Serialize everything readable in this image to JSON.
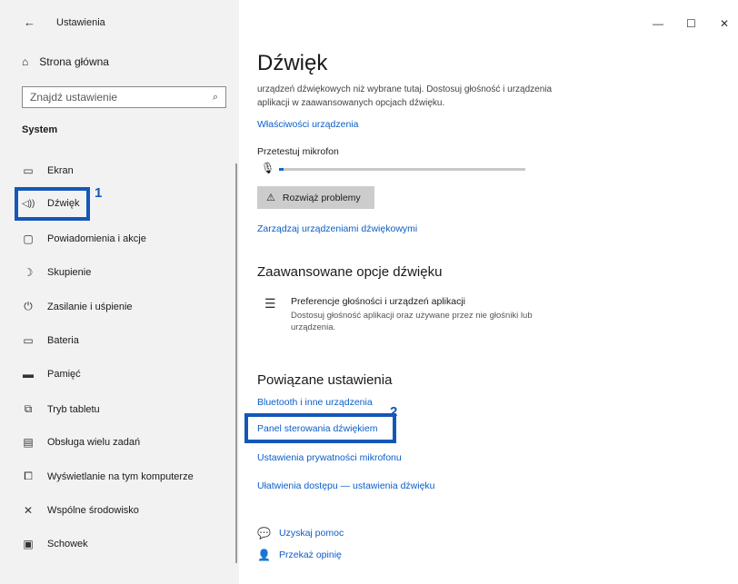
{
  "titlebar": {
    "title": "Ustawienia"
  },
  "sidebar": {
    "home_label": "Strona główna",
    "search_placeholder": "Znajdź ustawienie",
    "section": "System",
    "items": [
      {
        "label": "Ekran",
        "icon": "monitor-icon"
      },
      {
        "label": "Dźwięk",
        "icon": "speaker-icon"
      },
      {
        "label": "Powiadomienia i akcje",
        "icon": "notification-icon"
      },
      {
        "label": "Skupienie",
        "icon": "moon-icon"
      },
      {
        "label": "Zasilanie i uśpienie",
        "icon": "power-icon"
      },
      {
        "label": "Bateria",
        "icon": "battery-icon"
      },
      {
        "label": "Pamięć",
        "icon": "storage-icon"
      },
      {
        "label": "Tryb tabletu",
        "icon": "tablet-icon"
      },
      {
        "label": "Obsługa wielu zadań",
        "icon": "multitask-icon"
      },
      {
        "label": "Wyświetlanie na tym komputerze",
        "icon": "projecting-icon"
      },
      {
        "label": "Wspólne środowisko",
        "icon": "shared-experience-icon"
      },
      {
        "label": "Schowek",
        "icon": "clipboard-icon"
      }
    ],
    "callout": "1"
  },
  "main": {
    "title": "Dźwięk",
    "description": "urządzeń dźwiękowych niż wybrane tutaj. Dostosuj głośność i urządzenia aplikacji w zaawansowanych opcjach dźwięku.",
    "device_props_link": "Właściwości urządzenia",
    "mic_test_label": "Przetestuj mikrofon",
    "mic_level": 0.02,
    "troubleshoot_label": "Rozwiąż problemy",
    "manage_devices_link": "Zarządzaj urządzeniami dźwiękowymi",
    "advanced_heading": "Zaawansowane opcje dźwięku",
    "app_pref_title": "Preferencje głośności i urządzeń aplikacji",
    "app_pref_desc": "Dostosuj głośność aplikacji oraz używane przez nie głośniki lub urządzenia.",
    "related_heading": "Powiązane ustawienia",
    "related_links": [
      "Bluetooth i inne urządzenia",
      "Panel sterowania dźwiękiem",
      "Ustawienia prywatności mikrofonu",
      "Ułatwienia dostępu — ustawienia dźwięku"
    ],
    "callout": "2",
    "help_link": "Uzyskaj pomoc",
    "feedback_link": "Przekaż opinię"
  },
  "colors": {
    "accent": "#0a5ec9",
    "highlight": "#1457b8",
    "sidebar_bg": "#f2f2f2"
  }
}
